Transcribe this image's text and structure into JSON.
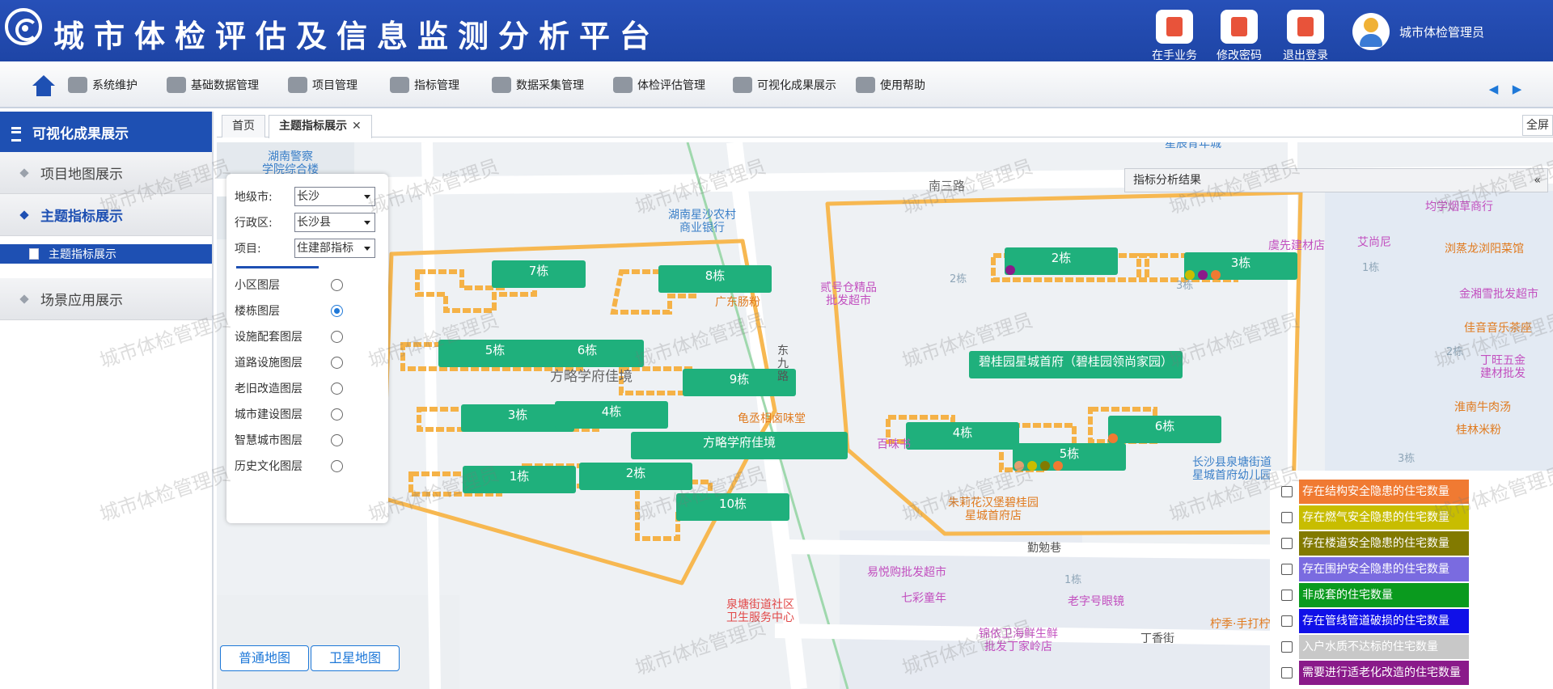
{
  "header": {
    "title": "城市体检评估及信息监测分析平台",
    "buttons": [
      {
        "label": "在手业务",
        "icon": "clipboard-icon"
      },
      {
        "label": "修改密码",
        "icon": "lock-icon"
      },
      {
        "label": "退出登录",
        "icon": "logout-icon"
      }
    ],
    "user_name": "城市体检管理员"
  },
  "nav": {
    "items": [
      "系统维护",
      "基础数据管理",
      "项目管理",
      "指标管理",
      "数据采集管理",
      "体检评估管理",
      "可视化成果展示",
      "使用帮助"
    ],
    "arrow_left": "◀",
    "arrow_right": "▶"
  },
  "sidebar": {
    "title": "可视化成果展示",
    "items": [
      {
        "label": "项目地图展示"
      },
      {
        "label": "主题指标展示"
      },
      {
        "label": "场景应用展示"
      }
    ],
    "sub_item": "主题指标展示"
  },
  "tabs": {
    "items": [
      {
        "label": "首页"
      },
      {
        "label": "主题指标展示"
      }
    ],
    "close": "✕",
    "fullscreen": "全屏"
  },
  "layer_panel": {
    "city_label": "地级市:",
    "city_value": "长沙",
    "district_label": "行政区:",
    "district_value": "长沙县",
    "project_label": "项目:",
    "project_value": "住建部指标",
    "layers": [
      {
        "label": "小区图层",
        "selected": false
      },
      {
        "label": "楼栋图层",
        "selected": true
      },
      {
        "label": "设施配套图层",
        "selected": false
      },
      {
        "label": "道路设施图层",
        "selected": false
      },
      {
        "label": "老旧改造图层",
        "selected": false
      },
      {
        "label": "城市建设图层",
        "selected": false
      },
      {
        "label": "智慧城市图层",
        "selected": false
      },
      {
        "label": "历史文化图层",
        "selected": false
      }
    ]
  },
  "result_panel": {
    "title": "指标分析结果",
    "collapse": "«"
  },
  "indicators": [
    {
      "label": "存在结构安全隐患的住宅数量",
      "color": "#f07a32"
    },
    {
      "label": "存在燃气安全隐患的住宅数量",
      "color": "#c8bd00"
    },
    {
      "label": "存在楼道安全隐患的住宅数量",
      "color": "#827a00"
    },
    {
      "label": "存在围护安全隐患的住宅数量",
      "color": "#7a6be0"
    },
    {
      "label": "非成套的住宅数量",
      "color": "#0a9a1e"
    },
    {
      "label": "存在管线管道破损的住宅数量",
      "color": "#1010e8"
    },
    {
      "label": "入户水质不达标的住宅数量",
      "color": "#c8c8c8"
    },
    {
      "label": "需要进行适老化改造的住宅数量",
      "color": "#8a1a8a"
    }
  ],
  "map_buttons": [
    "普通地图",
    "卫星地图"
  ],
  "buildings": [
    "7栋",
    "8栋",
    "5栋",
    "6栋",
    "9栋",
    "3栋",
    "4栋",
    "方略学府佳境",
    "1栋",
    "2栋",
    "10栋",
    "2栋",
    "3栋",
    "碧桂园星城首府（碧桂园领尚家园）",
    "4栋",
    "5栋",
    "6栋"
  ],
  "pois": {
    "p1": "湖南警察\n学院综合楼",
    "p2": "湖南星沙农村\n商业银行",
    "p3": "星辰青年城",
    "p4": "南三路",
    "p5": "均学烟草商行",
    "p6": "虞先建材店",
    "p7": "艾尚尼",
    "p8": "浏蒸龙浏阳菜馆",
    "p9": "贰号仓精品\n批发超市",
    "p10": "广东肠粉",
    "p11": "金湘雪批发超市",
    "p12": "佳音音乐茶座",
    "p13": "丁旺五金\n建材批发",
    "p14": "方略学府佳境",
    "p15": "龟丞相卤味堂",
    "p16": "淮南牛肉汤",
    "p17": "桂林米粉",
    "p18": "百味书",
    "p19": "长沙县泉塘街道\n星城首府幼儿园",
    "p20": "朱莉花汉堡碧桂园\n星城首府店",
    "p21": "勤勉巷",
    "p22": "易悦购批发超市",
    "p23": "七彩童年",
    "p24": "老字号眼镜",
    "p25": "泉塘街道社区\n卫生服务中心",
    "p26": "锦依卫海鲜生鲜\n批发丁家岭店",
    "p27": "丁香街",
    "p28": "柠季·手打柠",
    "p29": "东九路",
    "p30": "1栋",
    "p31": "2栋",
    "p32": "3栋",
    "p33": "3栋",
    "p34": "1栋",
    "p35": "2栋"
  },
  "watermark": "城市体检管理员"
}
